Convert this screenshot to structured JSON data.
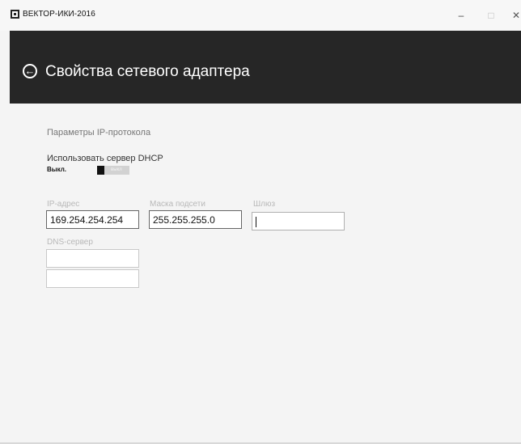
{
  "window": {
    "title": "ВЕКТОР-ИКИ-2016",
    "minimize_glyph": "–",
    "maximize_glyph": "□",
    "close_glyph": "✕"
  },
  "header": {
    "back_glyph": "←",
    "title": "Свойства сетевого адаптера"
  },
  "ip_settings": {
    "section_title": "Параметры IP-протокола",
    "dhcp": {
      "label": "Использовать сервер DHCP",
      "state": "Выкл.",
      "toggle_text": "выкл",
      "enabled": false
    },
    "ip_address": {
      "label": "IP-адрес",
      "value": "169.254.254.254"
    },
    "subnet_mask": {
      "label": "Маска подсети",
      "value": "255.255.255.0"
    },
    "gateway": {
      "label": "Шлюз",
      "value": ""
    },
    "dns": {
      "label": "DNS-сервер",
      "primary": "",
      "secondary": ""
    }
  },
  "colors": {
    "header_bg": "#262626",
    "page_bg": "#f4f4f4"
  }
}
